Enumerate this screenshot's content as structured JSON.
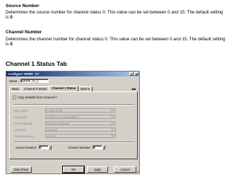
{
  "doc": {
    "source_number_heading": "Source Number",
    "source_number_text": "Determines the source number for channel status 0. This value can be set between 0 and 15. The default setting is",
    "source_number_default": "0",
    "channel_number_heading": "Channel Number",
    "channel_number_text": "Determines the channel number for channel status 0. This value can be set between 0 and 15. The default setting is",
    "channel_number_default": "0",
    "tab_heading": "Channel 1 Status Tab"
  },
  "dialog": {
    "title": "Configure 'SPDIF_Tx'",
    "title_buttons": [
      "?",
      "X"
    ],
    "name_label": "Name",
    "name_value": "SPDIF_Tx_1",
    "tabs": [
      "Basic",
      "Channel 0 Status",
      "Channel 1 Status",
      "Built-in"
    ],
    "active_tab": "Channel 1 Status",
    "tab_arrows": "◀ ▶",
    "copy_defaults_label": "Copy defaults from Channel 0",
    "copy_defaults_checked": true,
    "fields": [
      {
        "label": "Data Type",
        "value": "Linear PCM"
      },
      {
        "label": "Copyright",
        "value": "Audio is not copyrighted"
      },
      {
        "label": "Pre-emphasis",
        "value": "No Pre-emphasis"
      },
      {
        "label": "Category",
        "value": "General"
      },
      {
        "label": "Clock Accuracy",
        "value": "Level II"
      }
    ],
    "source_number_label": "Source Number:",
    "source_number_value": "0",
    "channel_number_label": "Channel Number:",
    "channel_number_value": "0",
    "buttons": {
      "data_sheet": "Data Sheet",
      "ok": "OK",
      "apply": "Apply",
      "cancel": "Cancel"
    }
  }
}
